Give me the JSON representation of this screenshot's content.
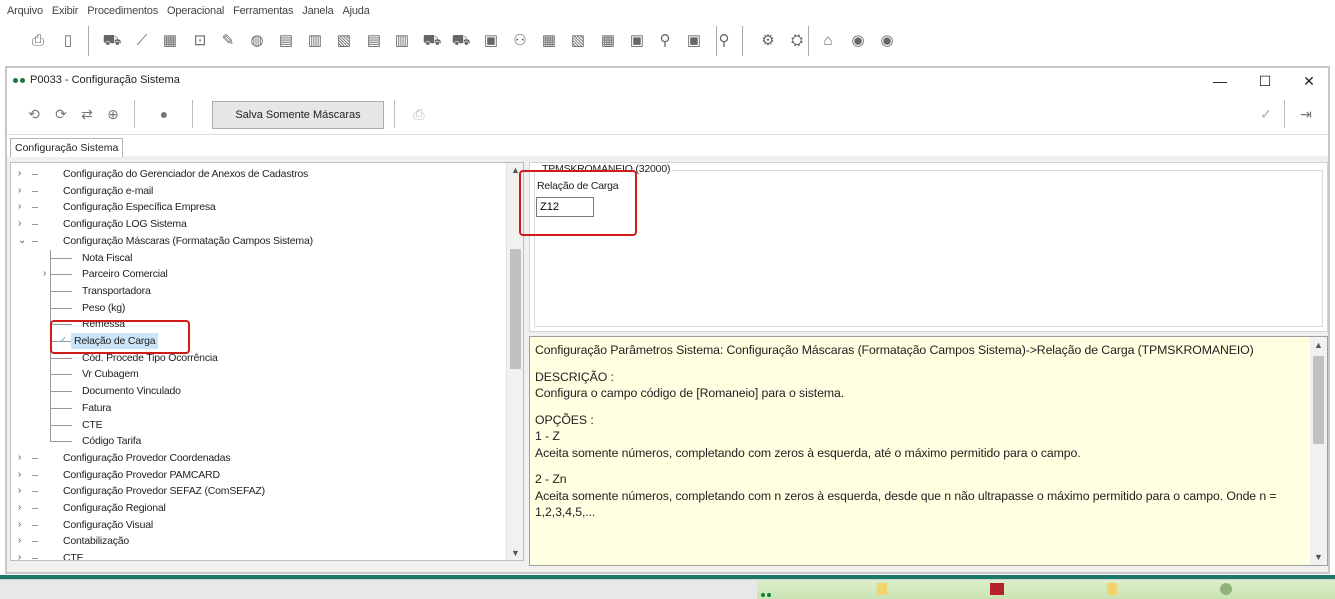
{
  "menu": {
    "items": [
      "Arquivo",
      "Exibir",
      "Procedimentos",
      "Operacional",
      "Ferramentas",
      "Janela",
      "Ajuda"
    ]
  },
  "toolbar": {
    "icons": [
      "printer-icon",
      "battery-icon",
      "truck-icon",
      "road-icon",
      "calculator-icon",
      "inbox-icon",
      "pen-icon",
      "globe-icon",
      "document-icon",
      "form-icon",
      "edit-icon",
      "list-icon",
      "report-icon",
      "truck-delivery-icon",
      "truck-load-icon",
      "cargo-icon",
      "team-icon",
      "ledger-icon",
      "chart-icon",
      "box-icon",
      "route-icon",
      "map-route-icon",
      "location-icon",
      "settings-icon",
      "support-icon",
      "factory-icon",
      "user-circle-icon",
      "group-icon",
      "key-user-icon"
    ]
  },
  "window": {
    "title": "P0033 - Configuração Sistema",
    "controls": {
      "minimize": "—",
      "maximize": "☐",
      "close": "✕"
    },
    "toolbar": {
      "save_masks_label": "Salva Somente Máscaras"
    },
    "tab_label": "Configuração Sistema"
  },
  "tree": {
    "items": [
      {
        "label": "Configuração do Gerenciador de Anexos de Cadastros",
        "level": 0,
        "expander": ">"
      },
      {
        "label": "Configuração e-mail",
        "level": 0,
        "expander": ">"
      },
      {
        "label": "Configuração Específica Empresa",
        "level": 0,
        "expander": ">"
      },
      {
        "label": "Configuração LOG Sistema",
        "level": 0,
        "expander": ">"
      },
      {
        "label": "Configuração Máscaras (Formatação Campos Sistema)",
        "level": 0,
        "expander": "v"
      },
      {
        "label": "Nota Fiscal",
        "level": 1,
        "expander": ""
      },
      {
        "label": "Parceiro Comercial",
        "level": 1,
        "expander": ">"
      },
      {
        "label": "Transportadora",
        "level": 1,
        "expander": ""
      },
      {
        "label": "Peso (kg)",
        "level": 1,
        "expander": ""
      },
      {
        "label": "Remessa",
        "level": 1,
        "expander": ""
      },
      {
        "label": "Relação de Carga",
        "level": 1,
        "expander": "",
        "selected": true
      },
      {
        "label": "Cód. Procede Tipo Ocorrência",
        "level": 1,
        "expander": ""
      },
      {
        "label": "Vr Cubagem",
        "level": 1,
        "expander": ""
      },
      {
        "label": "Documento Vinculado",
        "level": 1,
        "expander": ""
      },
      {
        "label": "Fatura",
        "level": 1,
        "expander": ""
      },
      {
        "label": "CTE",
        "level": 1,
        "expander": ""
      },
      {
        "label": "Código Tarifa",
        "level": 1,
        "expander": ""
      },
      {
        "label": "Configuração Provedor Coordenadas",
        "level": 0,
        "expander": ">"
      },
      {
        "label": "Configuração Provedor PAMCARD",
        "level": 0,
        "expander": ">"
      },
      {
        "label": "Configuração Provedor SEFAZ (ComSEFAZ)",
        "level": 0,
        "expander": ">"
      },
      {
        "label": "Configuração Regional",
        "level": 0,
        "expander": ">"
      },
      {
        "label": "Configuração Visual",
        "level": 0,
        "expander": ">"
      },
      {
        "label": "Contabilização",
        "level": 0,
        "expander": ">"
      },
      {
        "label": "CTE",
        "level": 0,
        "expander": ">"
      }
    ]
  },
  "detail": {
    "group_label": "TPMSKROMANEIO (32000)",
    "field_label": "Relação de Carga",
    "field_value": "Z12"
  },
  "help": {
    "lines": [
      "Configuração Parâmetros Sistema: Configuração Máscaras (Formatação Campos Sistema)->Relação de Carga (TPMSKROMANEIO)",
      "",
      "DESCRIÇÃO :",
      "Configura o campo código de [Romaneio] para o sistema.",
      "",
      "OPÇÕES :",
      "1 - Z",
      "Aceita somente números, completando com zeros à esquerda, até o máximo permitido para o campo.",
      "",
      "2 - Zn",
      "Aceita somente números, completando com n zeros à esquerda, desde que n não ultrapasse o máximo permitido para o campo. Onde n = 1,2,3,4,5,..."
    ]
  },
  "colors": {
    "highlight_red": "#d11a1a",
    "help_background": "#ffffe1",
    "selection": "#cce4f7",
    "teal_bar": "#1a7a6a"
  }
}
